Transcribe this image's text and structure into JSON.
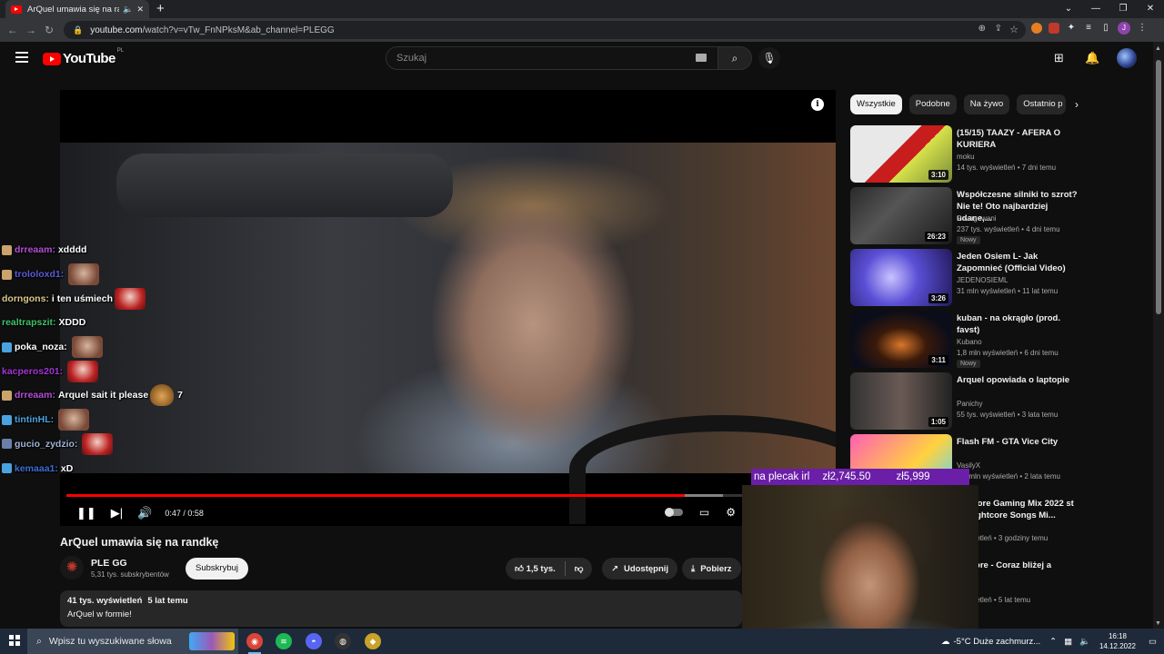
{
  "browser": {
    "tab_title": "ArQuel umawia się na randkę",
    "new_tab": "+",
    "url_host": "youtube.com",
    "url_path": "/watch?v=vTw_FnNPksM&ab_channel=PLEGG"
  },
  "header": {
    "logo_text": "YouTube",
    "country_code": "PL",
    "search_placeholder": "Szukaj"
  },
  "player": {
    "time": "0:47 / 0:58",
    "played_fraction": 0.81,
    "loaded_fraction": 0.86
  },
  "chat": [
    {
      "user": "drreaam:",
      "message": "xdddd",
      "user_color": "#b54fd8",
      "badge": "#c9a46b",
      "emote": ""
    },
    {
      "user": "trololoxd1:",
      "message": "",
      "user_color": "#5b5bd6",
      "badge": "#c9a46b",
      "emote": "face"
    },
    {
      "user": "dorngons:",
      "message": "i ten uśmiech",
      "user_color": "#d9c98a",
      "badge": "",
      "emote": "red"
    },
    {
      "user": "realtrapszit:",
      "message": "XDDD",
      "user_color": "#3fc26a",
      "badge": "",
      "emote": ""
    },
    {
      "user": "poka_noza:",
      "message": "",
      "user_color": "#ffffff",
      "badge": "#4aa3df",
      "emote": "face"
    },
    {
      "user": "kacperos201:",
      "message": "",
      "user_color": "#a335d6",
      "badge": "",
      "emote": "red"
    },
    {
      "user": "drreaam:",
      "message": "Arquel sait it please",
      "user_color": "#b54fd8",
      "badge": "#c9a46b",
      "emote": "gold",
      "suffix": "7"
    },
    {
      "user": "tintinHL:",
      "message": "",
      "user_color": "#4aa3df",
      "badge": "#4aa3df",
      "emote": "face"
    },
    {
      "user": "gucio_zydzio:",
      "message": "",
      "user_color": "#9fb3d6",
      "badge": "#6b7fa8",
      "emote": "red"
    },
    {
      "user": "kemaaa1:",
      "message": "xD",
      "user_color": "#3a6fd6",
      "badge": "#4aa3df",
      "emote": ""
    }
  ],
  "video": {
    "title": "ArQuel umawia się na randkę",
    "channel": "PLE GG",
    "subscribers": "5,31 tys. subskrybentów",
    "subscribe_label": "Subskrybuj",
    "likes": "1,5 tys.",
    "share_label": "Udostępnij",
    "download_label": "Pobierz",
    "views": "41 tys. wyświetleń",
    "date": "5 lat temu",
    "description": "ArQuel w formie!"
  },
  "sidebar": {
    "chips": [
      "Wszystkie",
      "Podobne",
      "Na żywo",
      "Ostatnio p"
    ],
    "recommendations": [
      {
        "title": "(15/15) TAAZY - AFERA O KURIERA",
        "channel": "moku",
        "meta": "14 tys. wyświetleń • 7 dni temu",
        "duration": "3:10",
        "badge": ""
      },
      {
        "title": "Współczesne silniki to szrot? Nie te! Oto najbardziej udane,...",
        "channel": "Povagowani",
        "meta": "237 tys. wyświetleń • 4 dni temu",
        "duration": "26:23",
        "badge": "Nowy"
      },
      {
        "title": "Jeden Osiem L- Jak Zapomnieć (Official Video)",
        "channel": "JEDENOSIEML",
        "meta": "31 mln wyświetleń • 11 lat temu",
        "duration": "3:26",
        "badge": ""
      },
      {
        "title": "kuban - na okrągło (prod. favst)",
        "channel": "Kubano",
        "meta": "1,8 mln wyświetleń • 6 dni temu",
        "duration": "3:11",
        "badge": "Nowy"
      },
      {
        "title": "Arquel opowiada o laptopie",
        "channel": "Panichy",
        "meta": "55 tys. wyświetleń • 3 lata temu",
        "duration": "1:05",
        "badge": ""
      },
      {
        "title": "Flash FM - GTA Vice City",
        "channel": "VasilyX",
        "meta": "1,6 mln wyświetleń • 2 lata temu",
        "duration": "",
        "badge": ""
      },
      {
        "title": "ightcore Gaming Mix 2022 st of Nightcore Songs Mi...",
        "channel": "",
        "meta": "wyświetleń • 3 godziny temu",
        "duration": "",
        "badge": ""
      },
      {
        "title": "ghtcore - Coraz bliżej a",
        "channel": "vers",
        "meta": "wyświetleń • 5 lat temu",
        "duration": "",
        "badge": ""
      }
    ]
  },
  "stream_overlay": {
    "donation_label": "na plecak irl",
    "donation_current": "zł2,745.50",
    "donation_goal": "zł5,999"
  },
  "taskbar": {
    "search_placeholder": "Wpisz tu wyszukiwane słowa",
    "weather": "-5°C  Duże zachmurz...",
    "time": "16:18",
    "date": "14.12.2022"
  },
  "colors": {
    "accent": "#ff0000",
    "donation_bar": "#6b1fa8",
    "background": "#0f0f0f"
  }
}
